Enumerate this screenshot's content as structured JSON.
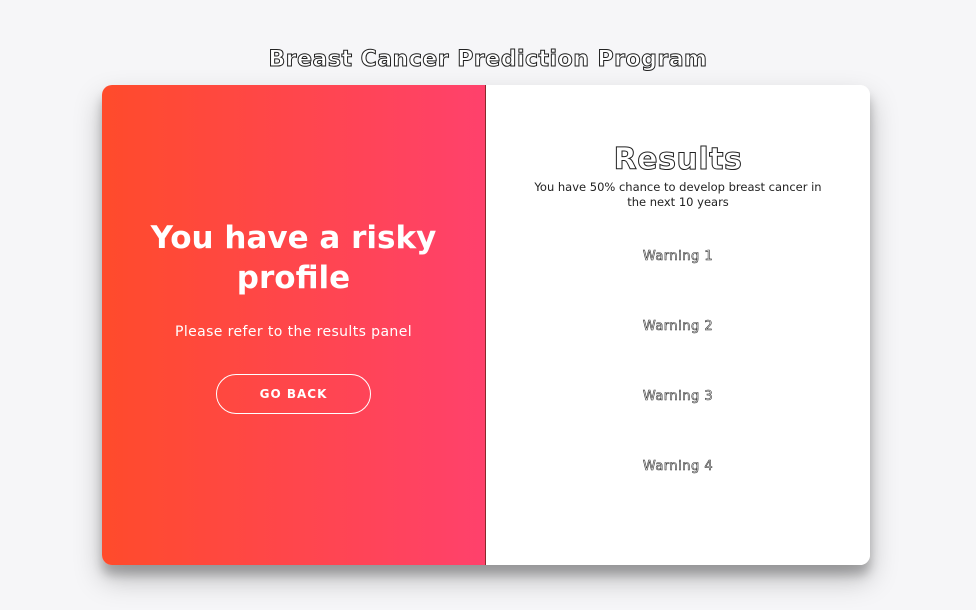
{
  "page": {
    "title": "Breast Cancer Prediction Program"
  },
  "left_panel": {
    "heading": "You have a risky profile",
    "subtext": "Please refer to the results panel",
    "button_label": "GO BACK"
  },
  "results": {
    "title": "Results",
    "description": "You have 50% chance to develop breast cancer in the next 10 years",
    "warnings": [
      "Warning 1",
      "Warning 2",
      "Warning 3",
      "Warning 4"
    ]
  },
  "colors": {
    "gradient_start": "#ff4b2b",
    "gradient_end": "#ff416c",
    "background": "#f6f6f8"
  }
}
